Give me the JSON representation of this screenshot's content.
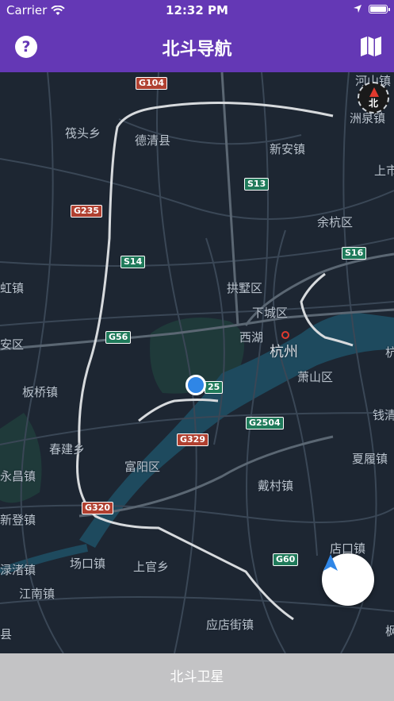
{
  "status_bar": {
    "carrier": "Carrier",
    "time": "12:32 PM"
  },
  "nav": {
    "title": "北斗导航",
    "help_icon": "?"
  },
  "map": {
    "labels": {
      "xiaoshan_top": "河山镇",
      "xiaoshan_right": "洲泉镇",
      "zhatou": "筏头乡",
      "deqing": "德清县",
      "xinan": "新安镇",
      "shangshi": "上市",
      "yuhang": "余杭区",
      "xiahong": "虹镇",
      "gongshu": "拱墅区",
      "xiacheng": "下城区",
      "anqu": "安区",
      "xihu": "西湖",
      "hangzhou": "杭州",
      "xiaoshan": "萧山区",
      "hang_right": "杭",
      "banqiao": "板桥镇",
      "qianqing": "钱清",
      "chunjian": "春建乡",
      "fuyang": "富阳区",
      "xialv": "夏履镇",
      "yongchang": "永昌镇",
      "daicun": "戴村镇",
      "xindeng": "新登镇",
      "diankou": "店口镇",
      "luzhu": "渌渚镇",
      "changkou": "场口镇",
      "shangguan": "上官乡",
      "jiangnan": "江南镇",
      "yingdian": "应店街镇",
      "xian": "县",
      "feng": "枫"
    },
    "shields": {
      "g104": "G104",
      "s13": "S13",
      "g235": "G235",
      "s14": "S14",
      "s16": "S16",
      "g56": "G56",
      "g25": "25",
      "g2504": "G2504",
      "g329": "G329",
      "g320": "G320",
      "g60": "G60"
    },
    "compass_label": "北"
  },
  "bottom": {
    "label": "北斗卫星"
  },
  "colors": {
    "accent": "#6438b5",
    "map_bg": "#1d2632",
    "bottom_bar": "#c3c3c5"
  }
}
